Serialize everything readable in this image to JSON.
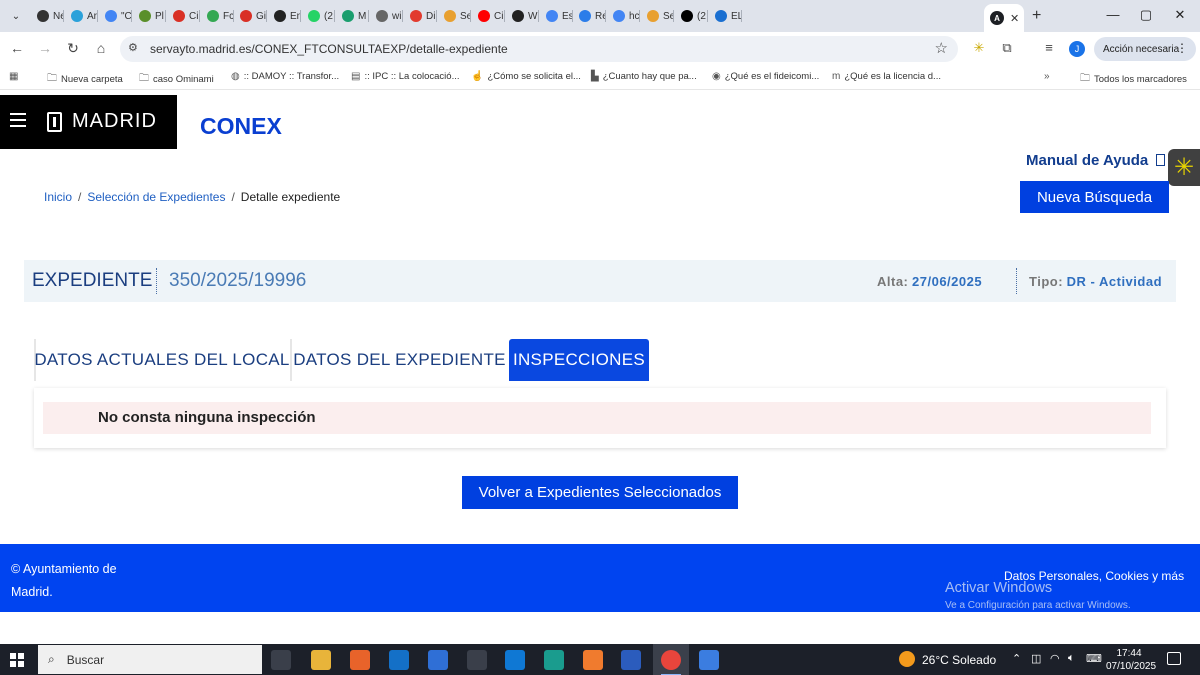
{
  "browser": {
    "tabs": [
      {
        "label": "Ne",
        "icon": "github-icon",
        "color": "#333333"
      },
      {
        "label": "Ar",
        "icon": "telegram-icon",
        "color": "#2aa1da"
      },
      {
        "label": "\"C",
        "icon": "google-icon",
        "color": "#4285f4"
      },
      {
        "label": "Pl",
        "icon": "search-icon",
        "color": "#5a8f2a"
      },
      {
        "label": "Ci",
        "icon": "gmail-icon",
        "color": "#d93025"
      },
      {
        "label": "Fc",
        "icon": "pinwheel-icon",
        "color": "#34a853"
      },
      {
        "label": "Gi",
        "icon": "gmail-icon",
        "color": "#d93025"
      },
      {
        "label": "En",
        "icon": "we-icon",
        "color": "#222222"
      },
      {
        "label": "(2",
        "icon": "whatsapp-icon",
        "color": "#25d366"
      },
      {
        "label": "M",
        "icon": "whatsapp-icon",
        "color": "#1a9e6e"
      },
      {
        "label": "wi",
        "icon": "globe-icon",
        "color": "#666666"
      },
      {
        "label": "Di",
        "icon": "circle-icon",
        "color": "#e23b2e"
      },
      {
        "label": "Se",
        "icon": "puzzle-icon",
        "color": "#e8a030"
      },
      {
        "label": "Ci",
        "icon": "youtube-icon",
        "color": "#ff0000"
      },
      {
        "label": "W",
        "icon": "we-icon",
        "color": "#222222"
      },
      {
        "label": "Es",
        "icon": "google-icon",
        "color": "#4285f4"
      },
      {
        "label": "Re",
        "icon": "bing-icon",
        "color": "#2b7de9"
      },
      {
        "label": "hc",
        "icon": "google-icon",
        "color": "#4285f4"
      },
      {
        "label": "Se",
        "icon": "puzzle-icon",
        "color": "#e8a030"
      },
      {
        "label": "(2",
        "icon": "x-icon",
        "color": "#000000"
      },
      {
        "label": "EL",
        "icon": "globe-icon",
        "color": "#1a6fd1"
      }
    ],
    "active_tab_icon": "angular-icon",
    "url": "servayto.madrid.es/CONEX_FTCONSULTAEXP/detalle-expediente",
    "profile_initial": "J",
    "action_label": "Acción necesaria",
    "bookmarks": [
      {
        "label": "Nueva carpeta",
        "icon": "folder-icon"
      },
      {
        "label": "caso Ominami",
        "icon": "folder-icon"
      },
      {
        "label": ":: DAMOY :: Transfor...",
        "icon": "globe-icon"
      },
      {
        "label": ":: IPC :: La colocació...",
        "icon": "chart-icon"
      },
      {
        "label": "¿Cómo se solicita el...",
        "icon": "hand-icon"
      },
      {
        "label": "¿Cuanto hay que pa...",
        "icon": "lt-icon"
      },
      {
        "label": "¿Qué es el fideicomi...",
        "icon": "eye-icon"
      },
      {
        "label": "¿Qué es la licencia d...",
        "icon": "m-icon"
      }
    ],
    "all_bookmarks_label": "Todos los marcadores"
  },
  "header": {
    "logo_text": "MADRID",
    "app_title": "CONEX",
    "help_link": "Manual de Ayuda"
  },
  "breadcrumb": {
    "home": "Inicio",
    "selection": "Selección de Expedientes",
    "current": "Detalle expediente"
  },
  "actions": {
    "new_search": "Nueva Búsqueda",
    "back": "Volver a Expedientes Seleccionados"
  },
  "expediente": {
    "label": "EXPEDIENTE",
    "number": "350/2025/19996",
    "alta_label": "Alta:",
    "alta_value": "27/06/2025",
    "tipo_label": "Tipo:",
    "tipo_value": "DR - Actividad"
  },
  "tabs": {
    "local": "DATOS ACTUALES DEL LOCAL",
    "expediente": "DATOS DEL EXPEDIENTE",
    "inspecciones": "INSPECCIONES",
    "active": "inspecciones"
  },
  "notice": "No consta ninguna inspección",
  "footer": {
    "copyright": "© Ayuntamiento de Madrid.",
    "links": "Datos Personales, Cookies y más"
  },
  "watermark": {
    "title": "Activar Windows",
    "subtitle": "Ve a Configuración para activar Windows."
  },
  "taskbar": {
    "search_placeholder": "Buscar",
    "weather": "26°C  Soleado",
    "time": "17:44",
    "date": "07/10/2025",
    "apps": [
      "task-view-icon",
      "file-explorer-icon",
      "firefox-icon",
      "outlook-icon",
      "store-icon",
      "media-icon",
      "outlook-new-icon",
      "edge-icon",
      "brave-icon",
      "word-icon",
      "chrome-icon",
      "photos-icon"
    ]
  },
  "colors": {
    "brand_blue": "#0040e0",
    "title_blue": "#0a3fd1",
    "dark_navy": "#1b3e80",
    "notice_bg": "#fbeeee",
    "footer_bg": "#0044f0"
  }
}
